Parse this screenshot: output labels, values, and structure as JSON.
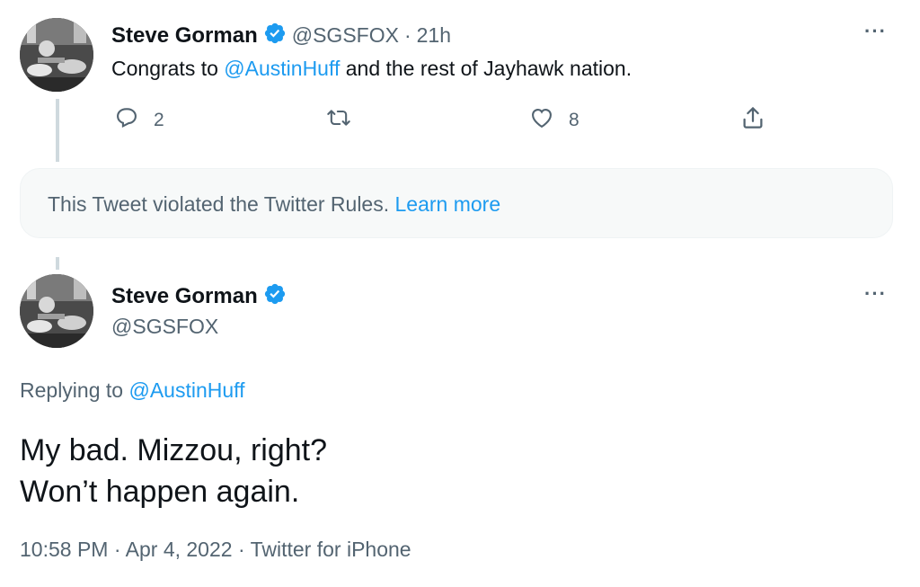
{
  "tweet1": {
    "name": "Steve Gorman",
    "handle": "@SGSFOX",
    "separator": "·",
    "time": "21h",
    "text_before": "Congrats to ",
    "mention": "@AustinHuff",
    "text_after": " and the rest of Jayhawk nation.",
    "replies": "2",
    "likes": "8",
    "more": "···"
  },
  "notice": {
    "text": "This Tweet violated the Twitter Rules.",
    "link": "Learn more"
  },
  "tweet2": {
    "name": "Steve Gorman",
    "handle": "@SGSFOX",
    "more": "···",
    "replying_to_label": "Replying to",
    "replying_to_mention": "@AustinHuff",
    "line1": "My bad. Mizzou, right?",
    "line2": "Won’t happen again.",
    "time": "10:58 PM",
    "date": "Apr 4, 2022",
    "source": "Twitter for iPhone",
    "separator": "·"
  },
  "colors": {
    "accent": "#1d9bf0",
    "text": "#0f1419",
    "muted": "#536471",
    "notice_bg": "#f7f9f9"
  },
  "icons": [
    "verified-badge-icon",
    "reply-icon",
    "retweet-icon",
    "like-icon",
    "share-icon",
    "more-icon"
  ]
}
